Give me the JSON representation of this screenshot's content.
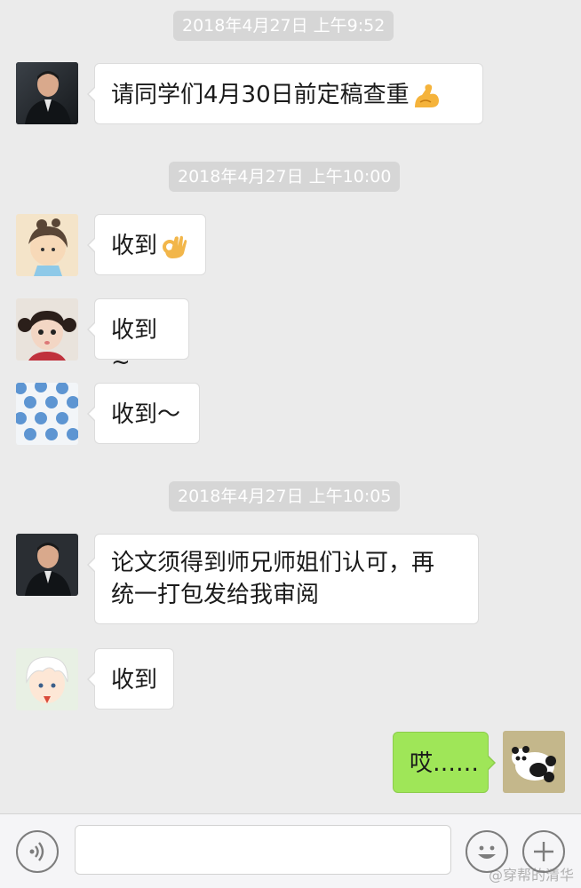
{
  "messages": [
    {
      "time": "2018年4月27日 上午9:52",
      "text": "请同学们4月30日前定稿查重",
      "emoji": "flexed-biceps-icon",
      "sender": "teacher"
    },
    {
      "time": "2018年4月27日 上午10:00"
    },
    {
      "text": "收到",
      "emoji": "ok-hand-icon",
      "sender": "student-1"
    },
    {
      "text": "收到~",
      "sender": "student-2"
    },
    {
      "text": "收到～",
      "sender": "student-3"
    },
    {
      "time": "2018年4月27日 上午10:05"
    },
    {
      "text_line1": "论文须得到师兄师姐们认可，再",
      "text_line2": "统一打包发给我审阅",
      "sender": "teacher"
    },
    {
      "text": "收到",
      "sender": "student-4"
    },
    {
      "text": "哎……",
      "sender": "me"
    }
  ],
  "watermark": "@穿帮的清华",
  "colors": {
    "background": "#ebebeb",
    "bubble_in": "#ffffff",
    "bubble_out": "#9fe658",
    "timestamp_bg": "#d6d6d6",
    "input_bar": "#f5f5f7"
  },
  "input_bar": {
    "voice_icon": "voice-icon",
    "emoji_icon": "emoji-face-icon",
    "add_icon": "plus-icon",
    "text": ""
  }
}
